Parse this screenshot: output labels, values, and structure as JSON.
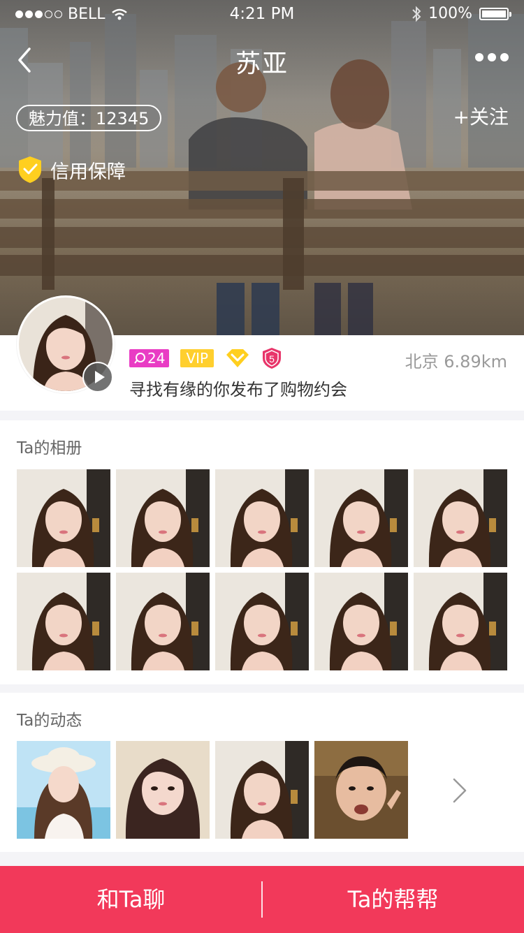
{
  "status_bar": {
    "carrier": "BELL",
    "time": "4:21 PM",
    "battery": "100%"
  },
  "nav": {
    "title": "苏亚",
    "back_icon": "chevron-left-icon",
    "more_icon": "more-dots-icon"
  },
  "hero": {
    "charm_label": "魅力值：12345",
    "follow_label": "+关注",
    "credit_label": "信用保障"
  },
  "profile": {
    "message_badge": "24",
    "vip_badge": "VIP",
    "level_badge": "5",
    "location": "北京 6.89km",
    "intro": "寻找有缘的你发布了购物约会"
  },
  "album": {
    "title": "Ta的相册",
    "photo_count": 10
  },
  "moments": {
    "title": "Ta的动态",
    "photo_count": 4
  },
  "actions": {
    "chat_label": "和Ta聊",
    "help_label": "Ta的帮帮"
  },
  "colors": {
    "accent": "#f2395a",
    "vip": "#ffcf2e",
    "message_badge": "#e93cc4",
    "level_badge": "#e8356a"
  }
}
